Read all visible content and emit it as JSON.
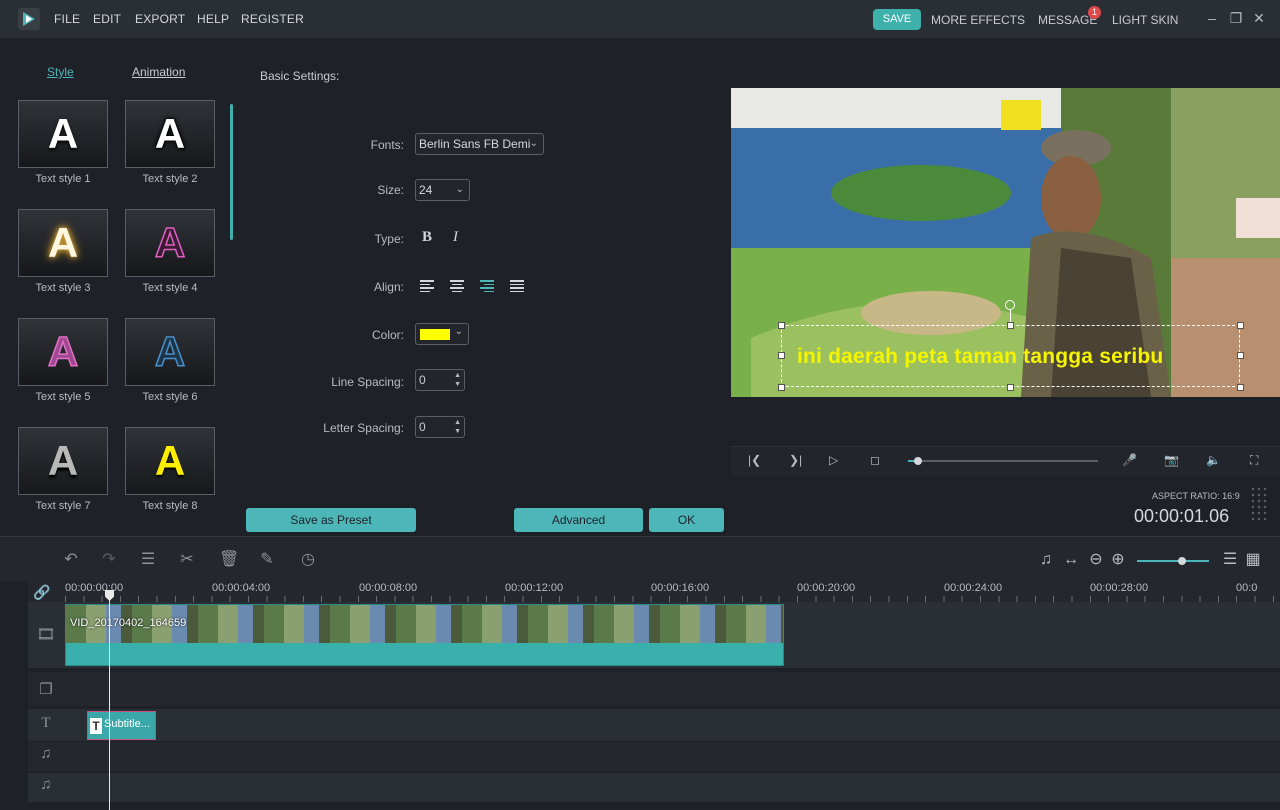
{
  "menubar": {
    "items": [
      "FILE",
      "EDIT",
      "EXPORT",
      "HELP",
      "REGISTER"
    ],
    "save": "SAVE",
    "more_effects": "MORE EFFECTS",
    "message": "MESSAGE",
    "message_badge": "1",
    "light_skin": "LIGHT SKIN"
  },
  "left_panel": {
    "tabs": {
      "style": "Style",
      "animation": "Animation"
    },
    "styles": [
      {
        "label": "Text style 1",
        "letter": "A"
      },
      {
        "label": "Text style 2",
        "letter": "A"
      },
      {
        "label": "Text style 3",
        "letter": "A"
      },
      {
        "label": "Text style 4",
        "letter": "A"
      },
      {
        "label": "Text style 5",
        "letter": "A"
      },
      {
        "label": "Text style 6",
        "letter": "A"
      },
      {
        "label": "Text style 7",
        "letter": "A"
      },
      {
        "label": "Text style 8",
        "letter": "A"
      }
    ]
  },
  "settings": {
    "heading": "Basic Settings:",
    "fonts_label": "Fonts:",
    "font_value": "Berlin Sans FB Demi",
    "size_label": "Size:",
    "size_value": "24",
    "type_label": "Type:",
    "bold": "B",
    "italic": "I",
    "align_label": "Align:",
    "color_label": "Color:",
    "color_value": "#ffff00",
    "line_spacing_label": "Line Spacing:",
    "line_spacing_value": "0",
    "letter_spacing_label": "Letter Spacing:",
    "letter_spacing_value": "0"
  },
  "buttons": {
    "save_preset": "Save as Preset",
    "advanced": "Advanced",
    "ok": "OK"
  },
  "preview": {
    "subtitle_text": "ini daerah peta taman tangga seribu",
    "aspect_ratio": "ASPECT RATIO: 16:9",
    "timecode": "00:00:01.06",
    "progress": 0.05
  },
  "timeline": {
    "ticks": [
      "00:00:00:00",
      "00:00:04:00",
      "00:00:08:00",
      "00:00:12:00",
      "00:00:16:00",
      "00:00:20:00",
      "00:00:24:00",
      "00:00:28:00",
      "00:0"
    ],
    "video_clip_name": "VID_20170402_164659",
    "subtitle_clip_name": "Subtitle...",
    "zoom_level": 0.63
  },
  "colors": {
    "accent": "#3fb1ad",
    "clip": "#39b0ac",
    "subtitle_text": "#f5f500"
  }
}
